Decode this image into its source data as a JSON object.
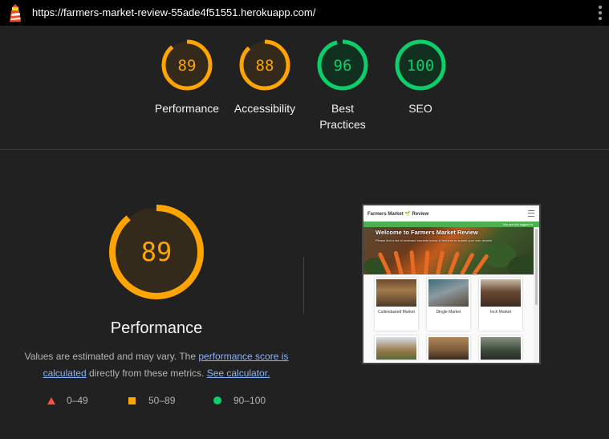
{
  "header": {
    "url": "https://farmers-market-review-55ade4f51551.herokuapp.com/"
  },
  "gauges": [
    {
      "label": "Performance",
      "score": 89,
      "color": "#ffa400",
      "fill": "#332a1b"
    },
    {
      "label": "Accessibility",
      "score": 88,
      "color": "#ffa400",
      "fill": "#332a1b"
    },
    {
      "label": "Best Practices",
      "score": 96,
      "color": "#0cce6b",
      "fill": "#11301f"
    },
    {
      "label": "SEO",
      "score": 100,
      "color": "#0cce6b",
      "fill": "#11301f"
    }
  ],
  "performance": {
    "score": 89,
    "title": "Performance",
    "desc_part1": "Values are estimated and may vary. The ",
    "link_score": "performance score is calculated",
    "desc_part2": " directly from these metrics. ",
    "link_calc": "See calculator."
  },
  "legend": {
    "fail": "0–49",
    "average": "50–89",
    "pass": "90–100"
  },
  "screenshot": {
    "brand": "Farmers Market 🌱 Review",
    "status": "You are not logged in",
    "hero_title": "Welcome to Farmers Market Review",
    "hero_sub": "Please find a list of reviewed markets below & feel free to submit your own review!",
    "cards": [
      "Cullendasted Market",
      "Dingle Market",
      "Inch Market"
    ]
  }
}
